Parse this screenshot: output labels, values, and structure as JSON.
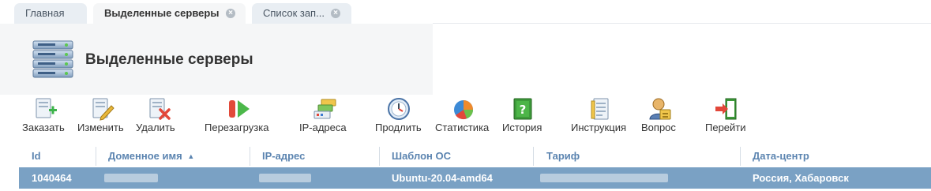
{
  "tabs": [
    {
      "label": "Главная",
      "closable": false,
      "active": false
    },
    {
      "label": "Выделенные серверы",
      "closable": true,
      "active": true
    },
    {
      "label": "Список зап...",
      "closable": true,
      "active": false
    }
  ],
  "page": {
    "title": "Выделенные серверы",
    "icon": "server-rack-icon"
  },
  "toolbar": [
    {
      "label": "Заказать",
      "icon": "order-add-icon"
    },
    {
      "label": "Изменить",
      "icon": "edit-icon"
    },
    {
      "label": "Удалить",
      "icon": "delete-icon"
    },
    {
      "label": "Перезагрузка",
      "icon": "reboot-icon"
    },
    {
      "label": "IP-адреса",
      "icon": "ip-addresses-icon"
    },
    {
      "label": "Продлить",
      "icon": "prolong-clock-icon"
    },
    {
      "label": "Статистика",
      "icon": "statistics-pie-icon"
    },
    {
      "label": "История",
      "icon": "history-book-icon"
    },
    {
      "label": "Инструкция",
      "icon": "instruction-doc-icon"
    },
    {
      "label": "Вопрос",
      "icon": "question-user-icon"
    },
    {
      "label": "Перейти",
      "icon": "goto-exit-icon"
    }
  ],
  "table": {
    "columns": [
      "Id",
      "Доменное имя",
      "IP-адрес",
      "Шаблон ОС",
      "Тариф",
      "Дата-центр"
    ],
    "sort": {
      "column": "Доменное имя",
      "direction": "asc"
    },
    "rows": [
      {
        "id": "1040464",
        "domain": "",
        "ip": "",
        "os_template": "Ubuntu-20.04-amd64",
        "tariff": "",
        "datacenter": "Россия, Хабаровск",
        "selected": true
      }
    ]
  },
  "colors": {
    "accent": "#5b84b0",
    "selected_row": "#7aa1c4",
    "tab_bg": "#e9eef3"
  }
}
